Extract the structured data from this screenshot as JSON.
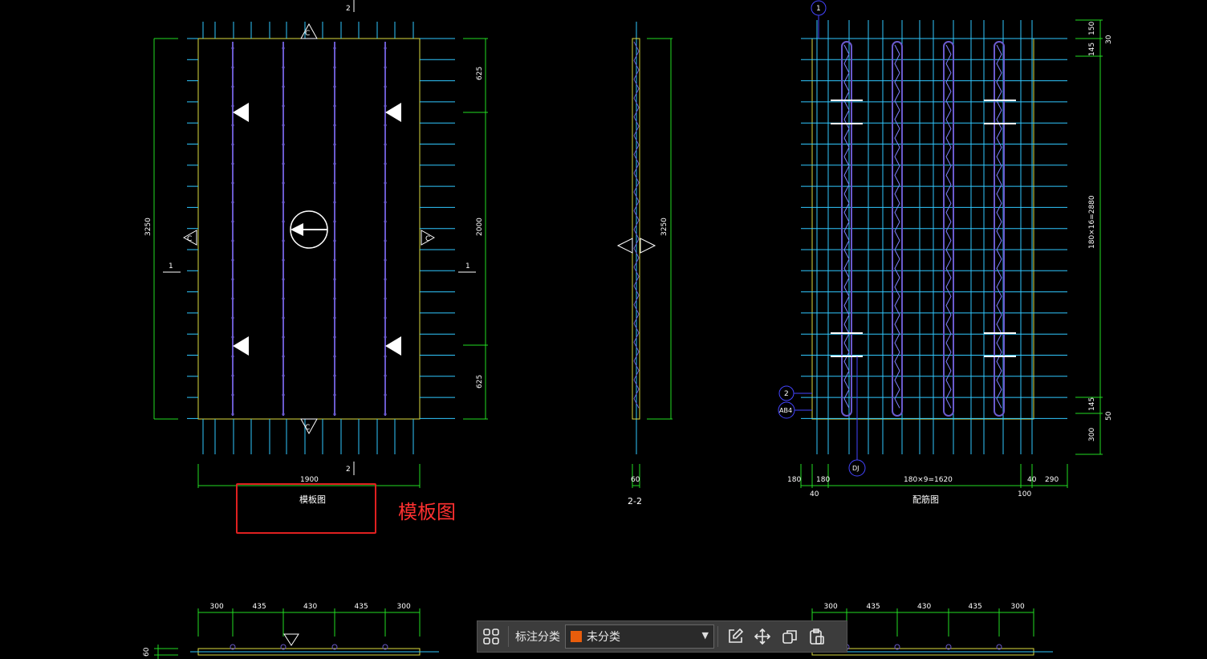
{
  "drawing": {
    "formwork": {
      "title": "模板图",
      "width_dim": "1900",
      "height_dim": "3250",
      "right_dims": [
        "625",
        "2000",
        "625"
      ],
      "section_tags": [
        "1",
        "1",
        "2",
        "2"
      ],
      "view_tag": "C",
      "bottom_dims": [
        "300",
        "435",
        "430",
        "435",
        "300"
      ],
      "bottom_side_dim": "60"
    },
    "section": {
      "title": "2-2",
      "height_dim": "3250",
      "width_dim": "60"
    },
    "rebar": {
      "title": "配筋图",
      "right_dims_top": [
        "150",
        "145",
        "30"
      ],
      "right_dim_mid": "180×16=2880",
      "right_dims_bottom": [
        "145",
        "50",
        "300"
      ],
      "bottom_dims": [
        "180",
        "180",
        "180×9=1620",
        "40",
        "290"
      ],
      "bottom_dims_lower": [
        "40",
        "100"
      ],
      "bubbles": [
        "1",
        "2",
        "AB4",
        "DJ"
      ],
      "lower_dims": [
        "300",
        "435",
        "430",
        "435",
        "300"
      ]
    }
  },
  "annotation": {
    "label": "模板图"
  },
  "toolbar": {
    "label": "标注分类",
    "select_value": "未分类",
    "swatch_color": "#e85d0c",
    "icons": [
      "grid-icon",
      "edit-icon",
      "move-icon",
      "copy-icon",
      "paste-icon"
    ]
  },
  "colors": {
    "green": "#22dd22",
    "cyan": "#30c8ff",
    "yellow": "#dcdc40",
    "purple": "#6a5acd",
    "blue": "#4444ff"
  }
}
